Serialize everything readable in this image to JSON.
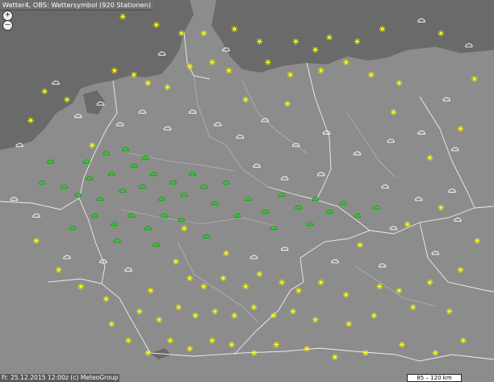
{
  "header": {
    "title": "Wetter4, OBS: Wettersymbol (920 Stationen)"
  },
  "controls": {
    "zoom_in_label": "+",
    "zoom_out_label": "–"
  },
  "footer": {
    "timestamp_credit": "Fr. 25.12.2015 12:00z (c) MeteoGroup"
  },
  "scale": {
    "label": "85 – 120 km"
  },
  "colors": {
    "land": "#8c8c8c",
    "sea": "#6a6a6a",
    "border": "#ffffff",
    "sun_symbol": "#ffff00",
    "rain_symbol": "#2ecc2e",
    "cloud_symbol": "#ffffff"
  },
  "symbols": [
    {
      "type": "sun",
      "lon": 7.2,
      "lat": 54.7
    },
    {
      "type": "sun",
      "lon": 8.4,
      "lat": 54.5
    },
    {
      "type": "sun",
      "lon": 9.3,
      "lat": 54.3
    },
    {
      "type": "sun",
      "lon": 10.1,
      "lat": 54.3
    },
    {
      "type": "sun",
      "lon": 11.2,
      "lat": 54.4
    },
    {
      "type": "sun",
      "lon": 12.1,
      "lat": 54.1
    },
    {
      "type": "sun",
      "lon": 13.4,
      "lat": 54.1
    },
    {
      "type": "sun",
      "lon": 14.1,
      "lat": 53.9
    },
    {
      "type": "sun",
      "lon": 14.6,
      "lat": 54.2
    },
    {
      "type": "sun",
      "lon": 15.6,
      "lat": 54.1
    },
    {
      "type": "sun",
      "lon": 16.5,
      "lat": 54.4
    },
    {
      "type": "sun",
      "lon": 18.6,
      "lat": 54.3
    },
    {
      "type": "sun",
      "lon": 6.9,
      "lat": 53.4
    },
    {
      "type": "sun",
      "lon": 7.6,
      "lat": 53.3
    },
    {
      "type": "sun",
      "lon": 8.1,
      "lat": 53.1
    },
    {
      "type": "sun",
      "lon": 8.8,
      "lat": 53.0
    },
    {
      "type": "sun",
      "lon": 9.6,
      "lat": 53.5
    },
    {
      "type": "sun",
      "lon": 10.4,
      "lat": 53.6
    },
    {
      "type": "sun",
      "lon": 11.0,
      "lat": 53.4
    },
    {
      "type": "sun",
      "lon": 12.4,
      "lat": 53.6
    },
    {
      "type": "sun",
      "lon": 13.2,
      "lat": 53.3
    },
    {
      "type": "sun",
      "lon": 14.3,
      "lat": 53.4
    },
    {
      "type": "sun",
      "lon": 15.2,
      "lat": 53.6
    },
    {
      "type": "sun",
      "lon": 16.1,
      "lat": 53.3
    },
    {
      "type": "sun",
      "lon": 17.1,
      "lat": 53.1
    },
    {
      "type": "sun",
      "lon": 11.6,
      "lat": 52.7
    },
    {
      "type": "sun",
      "lon": 13.1,
      "lat": 52.6
    },
    {
      "type": "sun",
      "lon": 4.4,
      "lat": 52.9
    },
    {
      "type": "sun",
      "lon": 5.2,
      "lat": 52.7
    },
    {
      "type": "sun",
      "lon": 3.9,
      "lat": 52.2
    },
    {
      "type": "sun",
      "lon": 6.1,
      "lat": 51.6
    },
    {
      "type": "sun",
      "lon": 16.9,
      "lat": 52.4
    },
    {
      "type": "sun",
      "lon": 19.3,
      "lat": 52.0
    },
    {
      "type": "sun",
      "lon": 19.8,
      "lat": 53.2
    },
    {
      "type": "sun",
      "lon": 18.2,
      "lat": 51.3
    },
    {
      "type": "sun",
      "lon": 9.1,
      "lat": 48.8
    },
    {
      "type": "sun",
      "lon": 9.6,
      "lat": 48.4
    },
    {
      "type": "sun",
      "lon": 10.1,
      "lat": 48.2
    },
    {
      "type": "sun",
      "lon": 10.8,
      "lat": 48.4
    },
    {
      "type": "sun",
      "lon": 11.6,
      "lat": 48.2
    },
    {
      "type": "sun",
      "lon": 12.1,
      "lat": 48.5
    },
    {
      "type": "sun",
      "lon": 12.9,
      "lat": 48.3
    },
    {
      "type": "sun",
      "lon": 13.5,
      "lat": 48.1
    },
    {
      "type": "sun",
      "lon": 14.3,
      "lat": 48.3
    },
    {
      "type": "sun",
      "lon": 15.2,
      "lat": 48.0
    },
    {
      "type": "sun",
      "lon": 16.4,
      "lat": 48.2
    },
    {
      "type": "sun",
      "lon": 17.1,
      "lat": 48.1
    },
    {
      "type": "sun",
      "lon": 18.2,
      "lat": 48.3
    },
    {
      "type": "sun",
      "lon": 19.3,
      "lat": 48.6
    },
    {
      "type": "sun",
      "lon": 19.9,
      "lat": 49.3
    },
    {
      "type": "sun",
      "lon": 8.2,
      "lat": 48.1
    },
    {
      "type": "sun",
      "lon": 7.8,
      "lat": 47.6
    },
    {
      "type": "sun",
      "lon": 8.5,
      "lat": 47.4
    },
    {
      "type": "sun",
      "lon": 9.2,
      "lat": 47.7
    },
    {
      "type": "sun",
      "lon": 9.8,
      "lat": 47.5
    },
    {
      "type": "sun",
      "lon": 10.5,
      "lat": 47.6
    },
    {
      "type": "sun",
      "lon": 11.2,
      "lat": 47.5
    },
    {
      "type": "sun",
      "lon": 11.9,
      "lat": 47.7
    },
    {
      "type": "sun",
      "lon": 12.6,
      "lat": 47.5
    },
    {
      "type": "sun",
      "lon": 13.3,
      "lat": 47.6
    },
    {
      "type": "sun",
      "lon": 14.1,
      "lat": 47.4
    },
    {
      "type": "sun",
      "lon": 15.3,
      "lat": 47.3
    },
    {
      "type": "sun",
      "lon": 16.2,
      "lat": 47.5
    },
    {
      "type": "sun",
      "lon": 17.6,
      "lat": 47.7
    },
    {
      "type": "sun",
      "lon": 18.9,
      "lat": 47.6
    },
    {
      "type": "sun",
      "lon": 7.4,
      "lat": 46.9
    },
    {
      "type": "sun",
      "lon": 8.1,
      "lat": 46.6
    },
    {
      "type": "sun",
      "lon": 8.9,
      "lat": 46.9
    },
    {
      "type": "sun",
      "lon": 9.6,
      "lat": 46.7
    },
    {
      "type": "sun",
      "lon": 10.4,
      "lat": 46.9
    },
    {
      "type": "sun",
      "lon": 11.1,
      "lat": 46.8
    },
    {
      "type": "sun",
      "lon": 11.9,
      "lat": 46.6
    },
    {
      "type": "sun",
      "lon": 12.7,
      "lat": 46.8
    },
    {
      "type": "sun",
      "lon": 13.8,
      "lat": 46.7
    },
    {
      "type": "sun",
      "lon": 14.8,
      "lat": 46.5
    },
    {
      "type": "sun",
      "lon": 15.9,
      "lat": 46.6
    },
    {
      "type": "sun",
      "lon": 17.2,
      "lat": 46.8
    },
    {
      "type": "sun",
      "lon": 18.4,
      "lat": 46.6
    },
    {
      "type": "sun",
      "lon": 19.4,
      "lat": 46.9
    },
    {
      "type": "sun",
      "lon": 6.8,
      "lat": 47.3
    },
    {
      "type": "sun",
      "lon": 10.9,
      "lat": 49.0
    },
    {
      "type": "sun",
      "lon": 9.4,
      "lat": 49.6
    },
    {
      "type": "sun",
      "lon": 15.7,
      "lat": 49.2
    },
    {
      "type": "sun",
      "lon": 17.4,
      "lat": 49.7
    },
    {
      "type": "sun",
      "lon": 18.6,
      "lat": 50.1
    },
    {
      "type": "sun",
      "lon": 4.1,
      "lat": 49.3
    },
    {
      "type": "sun",
      "lon": 4.9,
      "lat": 48.6
    },
    {
      "type": "sun",
      "lon": 5.7,
      "lat": 48.2
    },
    {
      "type": "sun",
      "lon": 6.6,
      "lat": 47.9
    },
    {
      "type": "rain",
      "lon": 5.1,
      "lat": 50.6
    },
    {
      "type": "rain",
      "lon": 5.6,
      "lat": 50.4
    },
    {
      "type": "rain",
      "lon": 6.0,
      "lat": 50.8
    },
    {
      "type": "rain",
      "lon": 6.4,
      "lat": 50.3
    },
    {
      "type": "rain",
      "lon": 6.8,
      "lat": 50.9
    },
    {
      "type": "rain",
      "lon": 7.2,
      "lat": 50.5
    },
    {
      "type": "rain",
      "lon": 7.6,
      "lat": 51.1
    },
    {
      "type": "rain",
      "lon": 7.9,
      "lat": 50.6
    },
    {
      "type": "rain",
      "lon": 8.3,
      "lat": 50.9
    },
    {
      "type": "rain",
      "lon": 8.6,
      "lat": 50.3
    },
    {
      "type": "rain",
      "lon": 9.0,
      "lat": 50.7
    },
    {
      "type": "rain",
      "lon": 9.4,
      "lat": 50.4
    },
    {
      "type": "rain",
      "lon": 9.7,
      "lat": 50.9
    },
    {
      "type": "rain",
      "lon": 10.1,
      "lat": 50.6
    },
    {
      "type": "rain",
      "lon": 10.5,
      "lat": 50.2
    },
    {
      "type": "rain",
      "lon": 10.9,
      "lat": 50.7
    },
    {
      "type": "rain",
      "lon": 6.2,
      "lat": 49.9
    },
    {
      "type": "rain",
      "lon": 6.9,
      "lat": 49.7
    },
    {
      "type": "rain",
      "lon": 7.5,
      "lat": 49.9
    },
    {
      "type": "rain",
      "lon": 8.1,
      "lat": 49.6
    },
    {
      "type": "rain",
      "lon": 8.7,
      "lat": 49.9
    },
    {
      "type": "rain",
      "lon": 9.3,
      "lat": 49.8
    },
    {
      "type": "rain",
      "lon": 5.4,
      "lat": 49.6
    },
    {
      "type": "rain",
      "lon": 5.9,
      "lat": 51.2
    },
    {
      "type": "rain",
      "lon": 6.6,
      "lat": 51.4
    },
    {
      "type": "rain",
      "lon": 7.3,
      "lat": 51.5
    },
    {
      "type": "rain",
      "lon": 8.0,
      "lat": 51.3
    },
    {
      "type": "rain",
      "lon": 4.6,
      "lat": 51.2
    },
    {
      "type": "rain",
      "lon": 4.3,
      "lat": 50.7
    },
    {
      "type": "rain",
      "lon": 11.7,
      "lat": 50.3
    },
    {
      "type": "rain",
      "lon": 12.3,
      "lat": 50.0
    },
    {
      "type": "rain",
      "lon": 12.9,
      "lat": 50.4
    },
    {
      "type": "rain",
      "lon": 13.5,
      "lat": 50.1
    },
    {
      "type": "rain",
      "lon": 14.1,
      "lat": 50.3
    },
    {
      "type": "rain",
      "lon": 14.6,
      "lat": 50.0
    },
    {
      "type": "rain",
      "lon": 15.1,
      "lat": 50.2
    },
    {
      "type": "rain",
      "lon": 15.6,
      "lat": 49.9
    },
    {
      "type": "rain",
      "lon": 12.6,
      "lat": 49.6
    },
    {
      "type": "rain",
      "lon": 13.9,
      "lat": 49.7
    },
    {
      "type": "rain",
      "lon": 7.0,
      "lat": 49.3
    },
    {
      "type": "rain",
      "lon": 8.4,
      "lat": 49.2
    },
    {
      "type": "rain",
      "lon": 11.3,
      "lat": 49.9
    },
    {
      "type": "rain",
      "lon": 16.3,
      "lat": 50.1
    },
    {
      "type": "rain",
      "lon": 10.2,
      "lat": 49.4
    },
    {
      "type": "cloud",
      "lon": 4.8,
      "lat": 53.1
    },
    {
      "type": "cloud",
      "lon": 5.6,
      "lat": 52.3
    },
    {
      "type": "cloud",
      "lon": 6.4,
      "lat": 52.6
    },
    {
      "type": "cloud",
      "lon": 7.1,
      "lat": 52.1
    },
    {
      "type": "cloud",
      "lon": 7.9,
      "lat": 52.4
    },
    {
      "type": "cloud",
      "lon": 8.8,
      "lat": 52.0
    },
    {
      "type": "cloud",
      "lon": 9.7,
      "lat": 52.4
    },
    {
      "type": "cloud",
      "lon": 10.6,
      "lat": 52.1
    },
    {
      "type": "cloud",
      "lon": 11.4,
      "lat": 51.8
    },
    {
      "type": "cloud",
      "lon": 12.3,
      "lat": 52.2
    },
    {
      "type": "cloud",
      "lon": 13.4,
      "lat": 51.6
    },
    {
      "type": "cloud",
      "lon": 14.5,
      "lat": 51.9
    },
    {
      "type": "cloud",
      "lon": 15.6,
      "lat": 51.4
    },
    {
      "type": "cloud",
      "lon": 16.8,
      "lat": 51.7
    },
    {
      "type": "cloud",
      "lon": 17.9,
      "lat": 51.9
    },
    {
      "type": "cloud",
      "lon": 19.1,
      "lat": 51.5
    },
    {
      "type": "cloud",
      "lon": 3.5,
      "lat": 51.6
    },
    {
      "type": "cloud",
      "lon": 3.3,
      "lat": 50.3
    },
    {
      "type": "cloud",
      "lon": 4.1,
      "lat": 49.9
    },
    {
      "type": "cloud",
      "lon": 12.0,
      "lat": 51.1
    },
    {
      "type": "cloud",
      "lon": 13.0,
      "lat": 50.8
    },
    {
      "type": "cloud",
      "lon": 14.3,
      "lat": 50.9
    },
    {
      "type": "cloud",
      "lon": 16.6,
      "lat": 50.6
    },
    {
      "type": "cloud",
      "lon": 17.8,
      "lat": 50.3
    },
    {
      "type": "cloud",
      "lon": 19.0,
      "lat": 50.5
    },
    {
      "type": "cloud",
      "lon": 16.9,
      "lat": 49.6
    },
    {
      "type": "cloud",
      "lon": 18.4,
      "lat": 49.0
    },
    {
      "type": "cloud",
      "lon": 6.5,
      "lat": 48.8
    },
    {
      "type": "cloud",
      "lon": 7.4,
      "lat": 48.6
    },
    {
      "type": "cloud",
      "lon": 5.2,
      "lat": 48.9
    },
    {
      "type": "cloud",
      "lon": 11.9,
      "lat": 48.9
    },
    {
      "type": "cloud",
      "lon": 13.0,
      "lat": 49.1
    },
    {
      "type": "cloud",
      "lon": 14.8,
      "lat": 48.8
    },
    {
      "type": "cloud",
      "lon": 16.5,
      "lat": 48.7
    },
    {
      "type": "cloud",
      "lon": 19.2,
      "lat": 49.8
    },
    {
      "type": "cloud",
      "lon": 8.6,
      "lat": 53.8
    },
    {
      "type": "cloud",
      "lon": 10.9,
      "lat": 53.9
    },
    {
      "type": "cloud",
      "lon": 17.9,
      "lat": 54.6
    },
    {
      "type": "cloud",
      "lon": 19.6,
      "lat": 54.0
    },
    {
      "type": "cloud",
      "lon": 18.8,
      "lat": 52.7
    }
  ]
}
